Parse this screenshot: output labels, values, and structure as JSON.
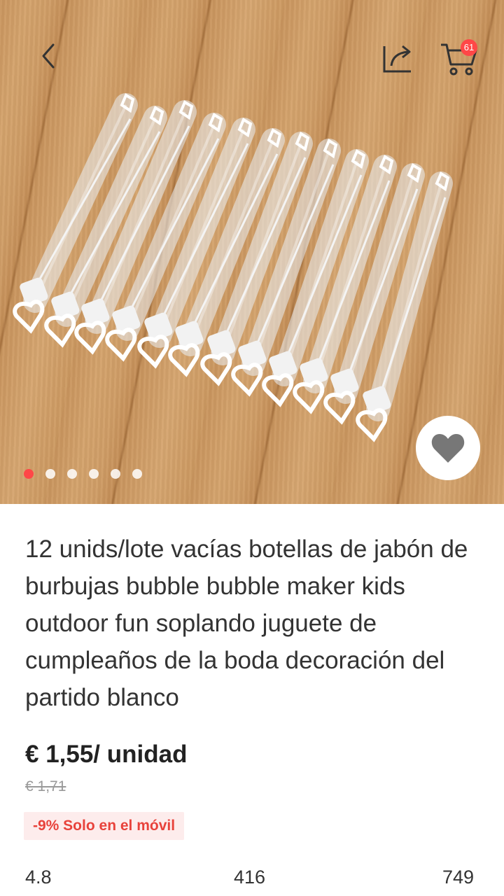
{
  "nav": {
    "back_icon": "chevron-left-icon",
    "share_icon": "share-icon",
    "cart_icon": "cart-icon",
    "cart_count": "61"
  },
  "gallery": {
    "image_count": 6,
    "active_index": 0
  },
  "product": {
    "title": "12 unids/lote vacías botellas de jabón de burbujas bubble bubble maker kids outdoor fun soplando juguete de cumpleaños de la boda decoración del partido blanco",
    "price": "€ 1,55/ unidad",
    "original_price": "€ 1,71",
    "promo": "-9% Solo en el móvil"
  },
  "stats": {
    "rating": "4.8",
    "reviews": "416",
    "orders": "749"
  },
  "colors": {
    "accent": "#ff4747",
    "promo_bg": "#fdecec",
    "promo_text": "#e8423b"
  }
}
